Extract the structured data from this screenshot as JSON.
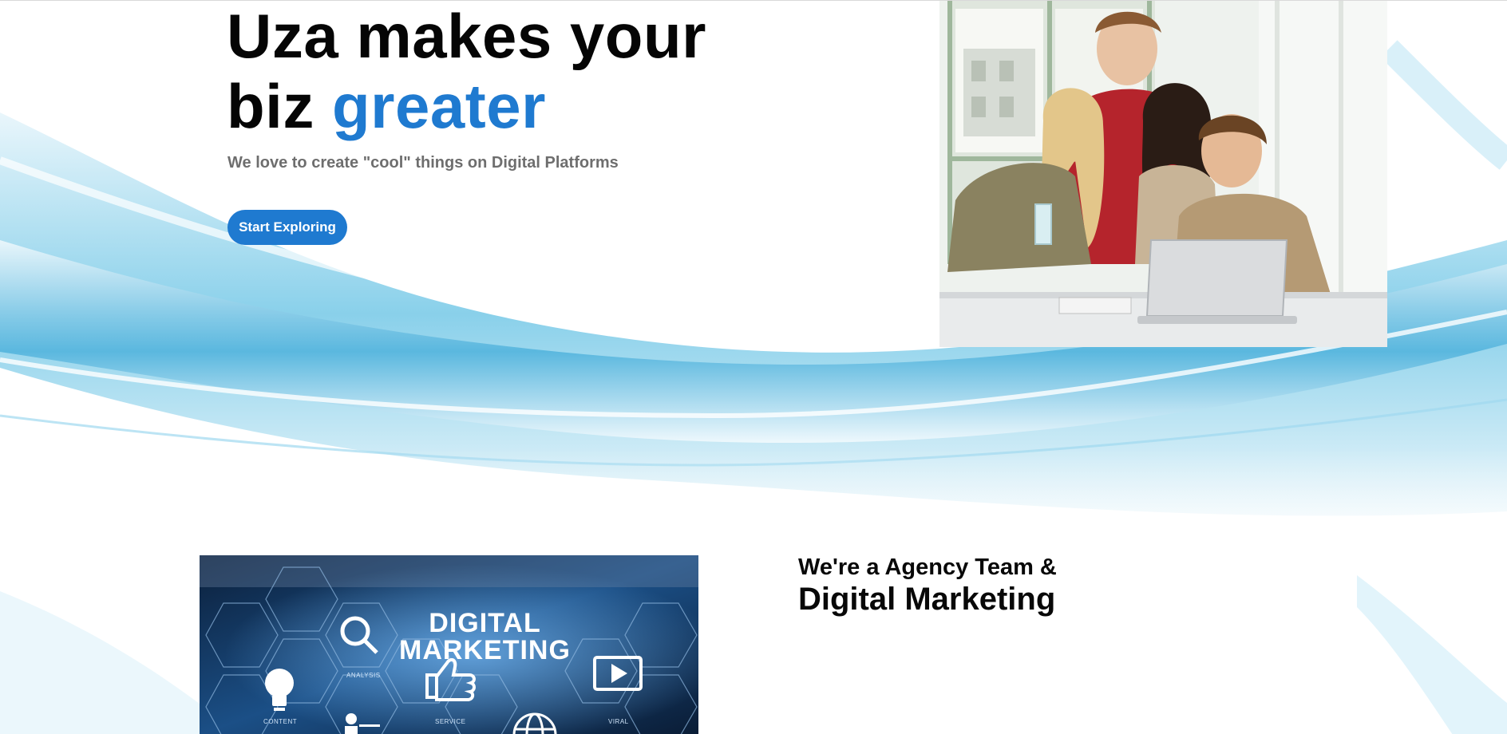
{
  "hero": {
    "title_line1": "Uza makes your",
    "title_line2_prefix": "biz ",
    "title_line2_accent": "greater",
    "subtitle": "We love to create \"cool\" things on Digital Platforms",
    "cta_label": "Start Exploring"
  },
  "about": {
    "subheading": "We're a Agency Team &",
    "heading": "Digital Marketing"
  },
  "dm_image": {
    "line1": "DIGITAL",
    "line2": "MARKETING",
    "labels": [
      "ANALYSIS",
      "CONTENT",
      "SERVICE",
      "VIRAL"
    ]
  },
  "colors": {
    "accent": "#1f7ad0",
    "title": "#050505",
    "subtitle": "#6e6e6e",
    "wave": "#5fbde0"
  },
  "icons": {
    "magnifier": "analysis-magnifier-icon",
    "bulb": "content-bulb-icon",
    "thumb": "service-thumbs-up-icon",
    "play": "viral-play-icon",
    "globe": "globe-icon"
  }
}
